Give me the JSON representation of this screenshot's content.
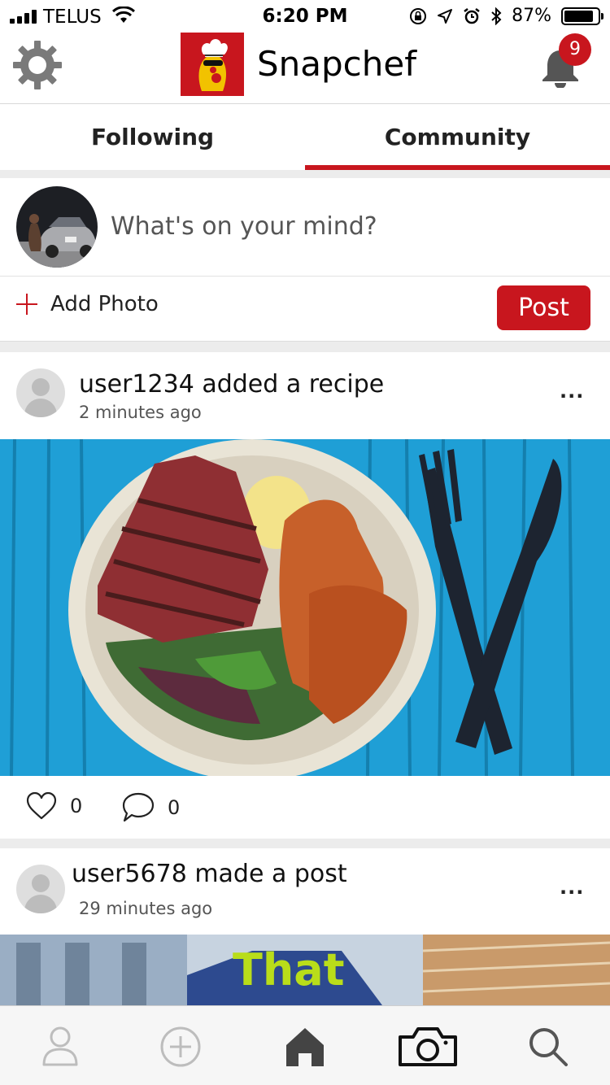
{
  "status_bar": {
    "carrier": "TELUS",
    "time": "6:20 PM",
    "battery_percent": "87%",
    "battery_level": 0.87,
    "icons": [
      "signal-icon",
      "wifi-icon",
      "orientation-lock-icon",
      "location-icon",
      "alarm-icon",
      "bluetooth-icon",
      "battery-icon"
    ]
  },
  "header": {
    "app_name": "Snapchef",
    "notification_count": "9",
    "icons": [
      "gear-icon",
      "chef-logo",
      "bell-icon"
    ]
  },
  "tabs": [
    {
      "label": "Following",
      "active": false
    },
    {
      "label": "Community",
      "active": true
    }
  ],
  "composer": {
    "placeholder": "What's on your mind?",
    "add_photo_label": "Add Photo",
    "post_label": "Post"
  },
  "feed": [
    {
      "title": "user1234 added a recipe",
      "time": "2 minutes ago",
      "more": "...",
      "likes": "0",
      "comments": "0",
      "image": "steak-bowl-photo"
    },
    {
      "title": "user5678 made a post",
      "time": "29 minutes ago",
      "more": "...",
      "image_text": "That"
    }
  ],
  "bottom_nav": {
    "items": [
      "profile-icon",
      "add-icon",
      "home-icon",
      "camera-icon",
      "search-icon"
    ],
    "active": "home-icon"
  },
  "colors": {
    "accent": "#c8161e",
    "divider": "#ececec",
    "nav_inactive": "#bdbdbd",
    "nav_active": "#333333"
  }
}
